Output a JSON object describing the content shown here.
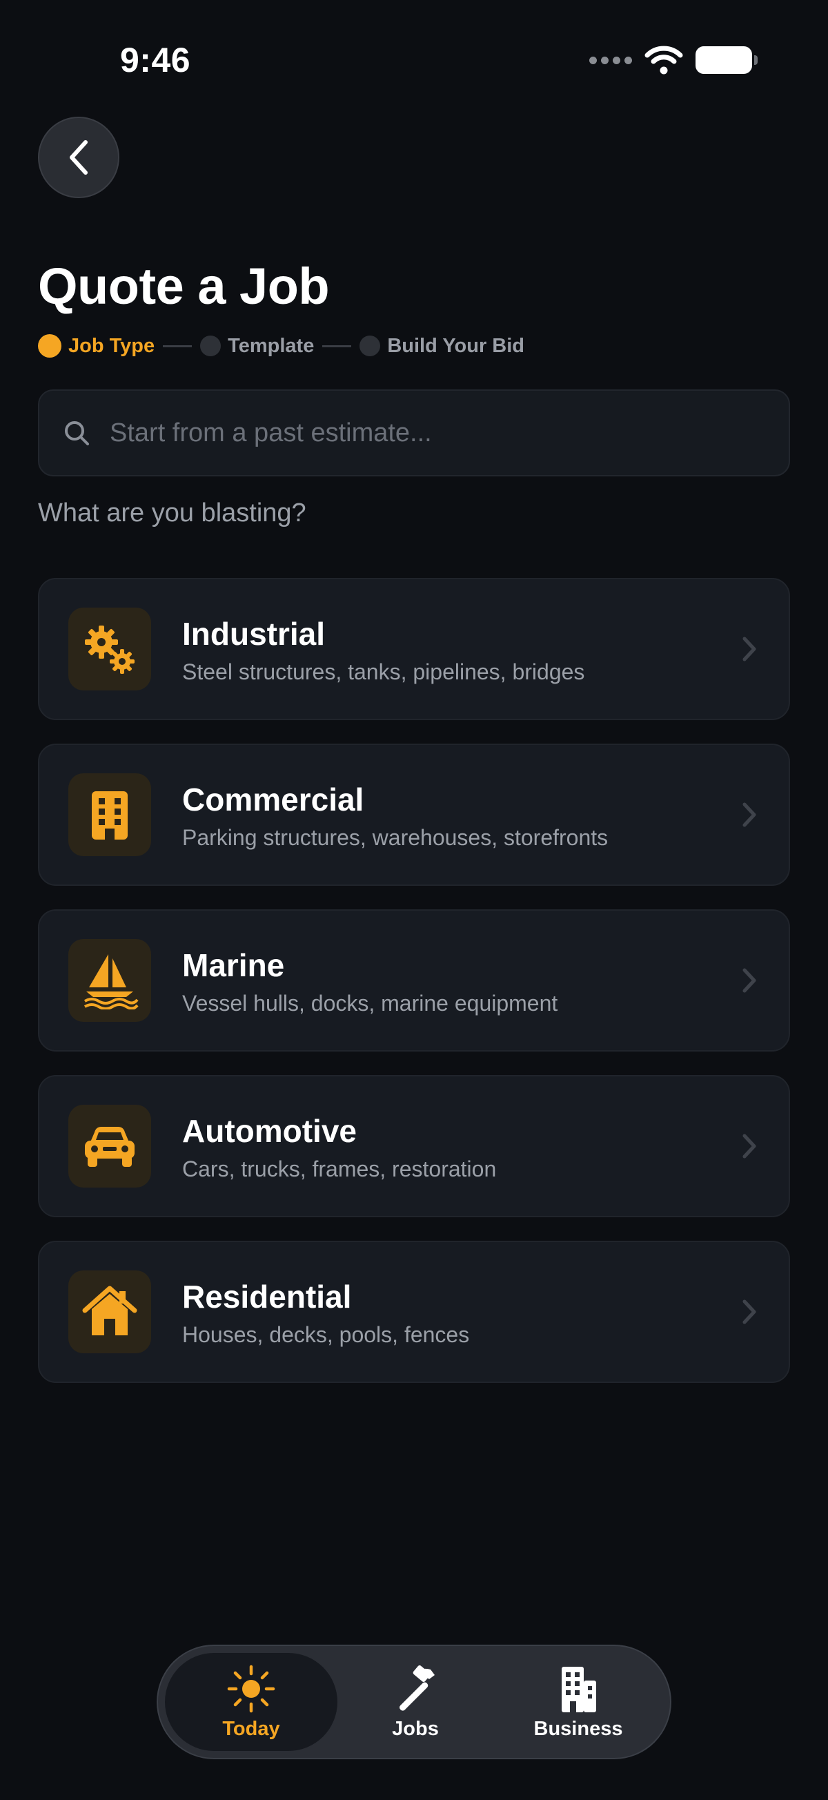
{
  "status_bar": {
    "time": "9:46"
  },
  "header": {
    "title": "Quote a Job"
  },
  "stepper": {
    "steps": [
      {
        "label": "Job Type",
        "active": true
      },
      {
        "label": "Template",
        "active": false
      },
      {
        "label": "Build Your Bid",
        "active": false
      }
    ]
  },
  "search": {
    "placeholder": "Start from a past estimate..."
  },
  "question": "What are you blasting?",
  "job_types": [
    {
      "title": "Industrial",
      "description": "Steel structures, tanks, pipelines, bridges",
      "icon": "gears-icon"
    },
    {
      "title": "Commercial",
      "description": "Parking structures, warehouses, storefronts",
      "icon": "building-icon"
    },
    {
      "title": "Marine",
      "description": "Vessel hulls, docks, marine equipment",
      "icon": "sailboat-icon"
    },
    {
      "title": "Automotive",
      "description": "Cars, trucks, frames, restoration",
      "icon": "car-icon"
    },
    {
      "title": "Residential",
      "description": "Houses, decks, pools, fences",
      "icon": "house-icon"
    }
  ],
  "tab_bar": {
    "tabs": [
      {
        "label": "Today",
        "icon": "sun-icon",
        "active": true
      },
      {
        "label": "Jobs",
        "icon": "hammer-icon",
        "active": false
      },
      {
        "label": "Business",
        "icon": "building-icon",
        "active": false
      }
    ]
  },
  "colors": {
    "accent": "#f5a623",
    "background": "#0c0e12",
    "card": "#171b22",
    "muted_text": "#9ba0a8"
  }
}
